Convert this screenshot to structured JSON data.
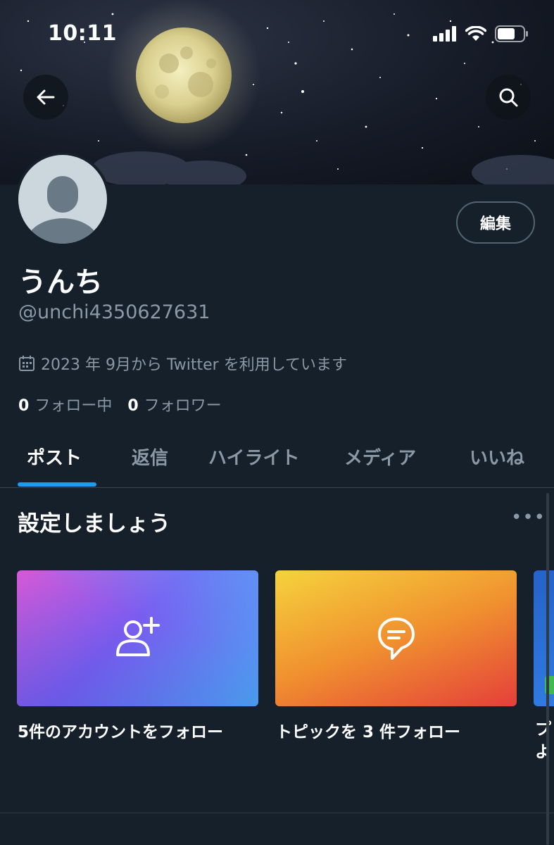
{
  "status_bar": {
    "time": "10:11"
  },
  "header": {
    "back_icon": "arrow-left-icon",
    "search_icon": "search-icon"
  },
  "profile": {
    "display_name": "うんち",
    "handle": "@unchi4350627631",
    "edit_label": "編集",
    "joined": "2023 年 9月から Twitter を利用しています",
    "following_count": "0",
    "following_label": "フォロー中",
    "followers_count": "0",
    "followers_label": "フォロワー"
  },
  "tabs": [
    {
      "label": "ポスト",
      "active": true
    },
    {
      "label": "返信"
    },
    {
      "label": "ハイライト"
    },
    {
      "label": "メディア"
    },
    {
      "label": "いいね"
    }
  ],
  "setup": {
    "title": "設定しましょう",
    "more": "•••",
    "cards": [
      {
        "label": "5件のアカウントをフォロー",
        "icon": "person-add-icon"
      },
      {
        "label": "トピックを 3 件フォロー",
        "icon": "topic-bubble-icon"
      },
      {
        "label": "プ\nよ",
        "icon": ""
      }
    ]
  },
  "colors": {
    "accent": "#1d9bf0",
    "background": "#15202b",
    "muted": "#8b98a5"
  }
}
